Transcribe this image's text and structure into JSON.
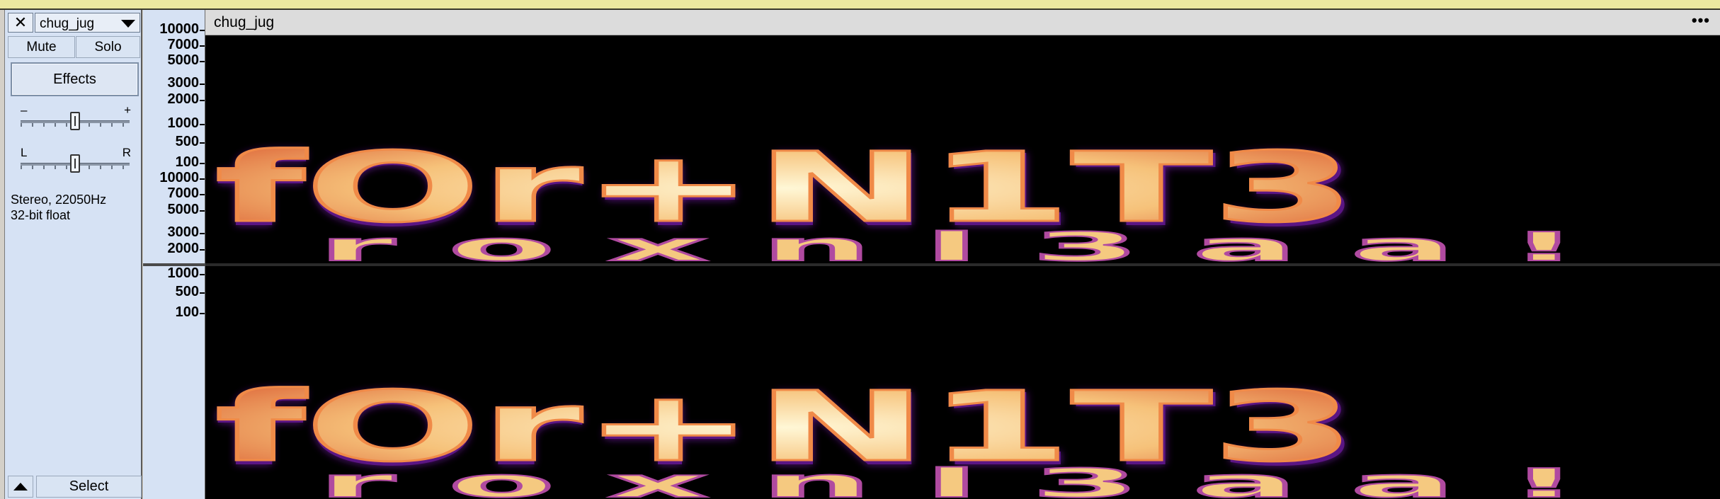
{
  "track": {
    "name": "chug_jug",
    "mute_label": "Mute",
    "solo_label": "Solo",
    "effects_label": "Effects",
    "gain_min_label": "–",
    "gain_max_label": "+",
    "pan_left_label": "L",
    "pan_right_label": "R",
    "info_line1": "Stereo, 22050Hz",
    "info_line2": "32-bit float",
    "select_label": "Select",
    "gain_level": 0.5,
    "pan_level": 0.5
  },
  "ruler": {
    "channel1_ticks": [
      "10000",
      "7000",
      "5000",
      "3000",
      "2000",
      "1000",
      "500",
      "100"
    ],
    "channel2_ticks": [
      "10000",
      "7000",
      "5000",
      "3000",
      "2000",
      "1000",
      "500",
      "100"
    ]
  },
  "clip": {
    "title": "chug_jug",
    "menu_label": "•••",
    "spectrogram_text_main": "fOr+N1T3",
    "spectrogram_text_lower": "r o x n l 3 a a !"
  },
  "icons": {
    "close": "close-icon",
    "dropdown": "chevron-down-icon",
    "collapse": "collapse-up-icon"
  },
  "colors": {
    "tcp_bg": "#d6e2f4",
    "spectrogram_bg": "#000000",
    "spectrogram_hot": "#fff3c4",
    "spectrogram_mid": "#f0a050",
    "spectrogram_low": "#6a1aa0"
  }
}
